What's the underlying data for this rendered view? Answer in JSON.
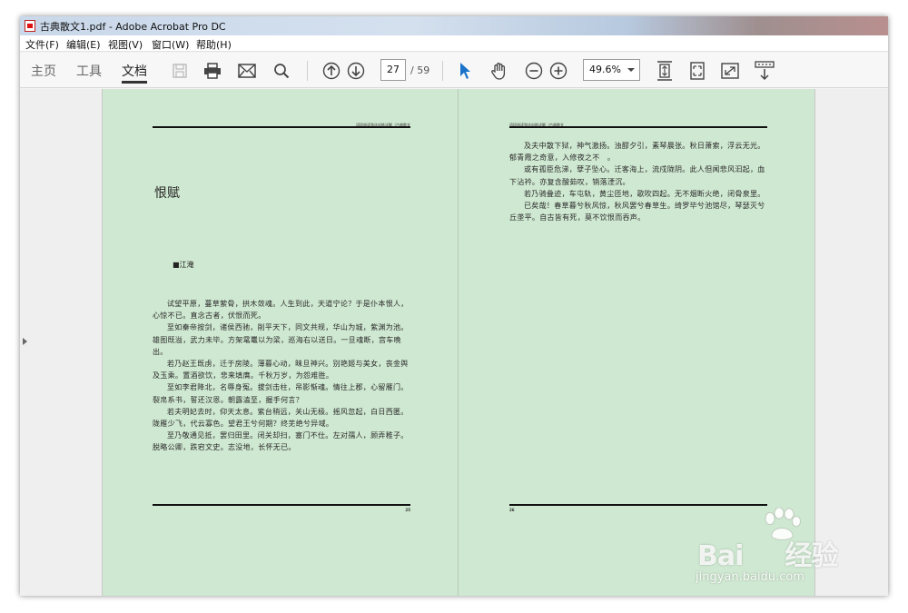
{
  "window": {
    "title": "古典散文1.pdf - Adobe Acrobat Pro DC"
  },
  "menu": [
    "文件(F)",
    "编辑(E)",
    "视图(V)",
    "窗口(W)",
    "帮助(H)"
  ],
  "nav_tabs": [
    {
      "label": "主页",
      "active": false
    },
    {
      "label": "工具",
      "active": false
    },
    {
      "label": "文档",
      "active": true
    }
  ],
  "toolbar": {
    "icons": [
      "save-icon",
      "print-icon",
      "email-icon",
      "search-icon",
      "page-up-icon",
      "page-down-icon",
      "select-cursor-icon",
      "hand-tool-icon",
      "zoom-out-icon",
      "zoom-in-icon",
      "fit-page-icon",
      "full-page-icon",
      "full-screen-icon",
      "scroll-mode-icon"
    ],
    "current_page": "27",
    "total_pages": "/ 59",
    "zoom": "49.6%"
  },
  "document": {
    "left_page": {
      "running_head": "语段阅读强化训练详解（古典散文",
      "heading": "恨赋",
      "author": "■江淹",
      "paragraphs": [
        "试望平原，蔓草萦骨，拱木敛魂。人生到此，天道宁论？于是仆本恨人，心惊不已。直念古者，伏恨而死。",
        "至如秦帝按剑，诸侯西驰，削平天下，同文共规，华山为城，紫渊为池。雄图既溢，武力未毕。方架鼋鼍以为梁，巡海右以送日。一旦魂断，宫车晚出。",
        "若乃赵王既虏，迁于房陵。薄暮心动，昧旦神兴。别艳姬与美女，丧金舆及玉乘。置酒欲饮，悲来填膺。千秋万岁，为怨难胜。",
        "至如李君降北，名辱身冤。拔剑击柱，吊影惭魂。情往上郡，心留雁门。裂帛系书，誓还汉恩。朝露溘至，握手何言？",
        "若夫明妃去时，仰天太息。紫台稍远，关山无极。摇风忽起，白日西匿。陇雁少飞，代云寡色。望君王兮何期？终芜绝兮异域。",
        "至乃敬通见抵，罢归田里。闭关却扫，塞门不仕。左对孺人，顾弄稚子。脱略公卿，跌宕文史。志没地，长怀无已。"
      ],
      "page_number": "25"
    },
    "right_page": {
      "running_head": "语段阅读强化训练详解（古典散文",
      "paragraphs": [
        "及夫中散下狱，神气激扬。浊醪夕引，素琴晨张。秋日萧索，浮云无光。郁青霞之奇意，入修夜之不　。",
        "或有孤臣危涕，孽子坠心。迁客海上，流戍陇阴。此人但闻悲风汩起，血下沾衿。亦复含酸茹叹，销落湮沉。",
        "若乃骑叠迹，车屯轨，黄尘匝地，歌吹四起。无不烟断火绝，闭骨泉里。",
        "已矣哉！春草暮兮秋风惊，秋风罢兮春草生。绮罗毕兮池馆尽，琴瑟灭兮丘垄平。自古皆有死，莫不饮恨而吞声。"
      ],
      "page_number": "26"
    }
  },
  "watermark": {
    "main": "Bai",
    "main_cn": "经验",
    "sub": "jingyan.baidu.com"
  },
  "colors": {
    "page_bg": "#cfe8d1",
    "toolbar_bg": "#f7f7f7",
    "select_tool": "#1a73c9"
  }
}
